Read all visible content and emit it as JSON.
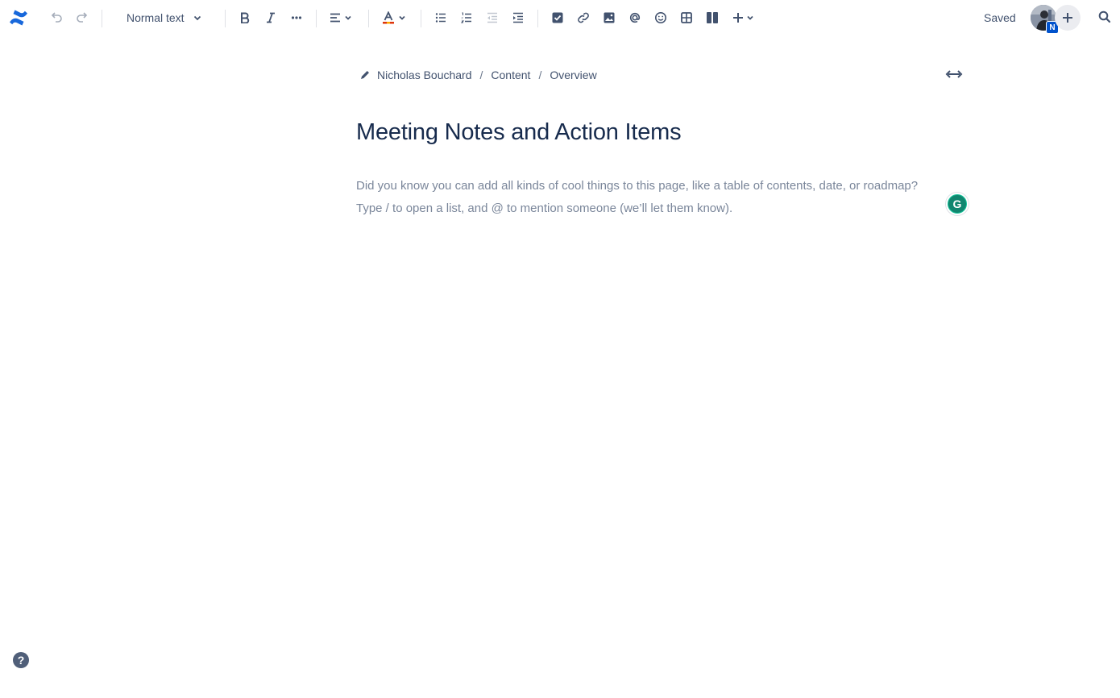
{
  "toolbar": {
    "text_style": "Normal text",
    "status": "Saved",
    "avatar_initial": "N",
    "icons": [
      "confluence-logo",
      "undo",
      "redo",
      "chevron-down",
      "bold",
      "italic",
      "more",
      "align",
      "chevron-down",
      "text-color",
      "chevron-down",
      "bullet-list",
      "numbered-list",
      "outdent",
      "indent",
      "action-item",
      "link",
      "image",
      "mention",
      "emoji",
      "table",
      "layouts",
      "insert",
      "chevron-down",
      "plus",
      "search"
    ]
  },
  "breadcrumb": {
    "items": [
      "Nicholas Bouchard",
      "Content",
      "Overview"
    ],
    "separator": "/"
  },
  "page": {
    "title": "Meeting Notes and Action Items",
    "placeholder_line1": "Did you know you can add all kinds of cool things to this page, like a table of contents, date, or roadmap?",
    "placeholder_line2": "Type / to open a list, and @ to mention someone (we’ll let them know)."
  },
  "grammarly": {
    "glyph": "G"
  },
  "help": {
    "glyph": "?"
  },
  "colors": {
    "brand": "#0052cc",
    "text": "#172b4d",
    "icon": "#42526e",
    "placeholder": "#7a869a",
    "grammarly": "#11866f"
  }
}
